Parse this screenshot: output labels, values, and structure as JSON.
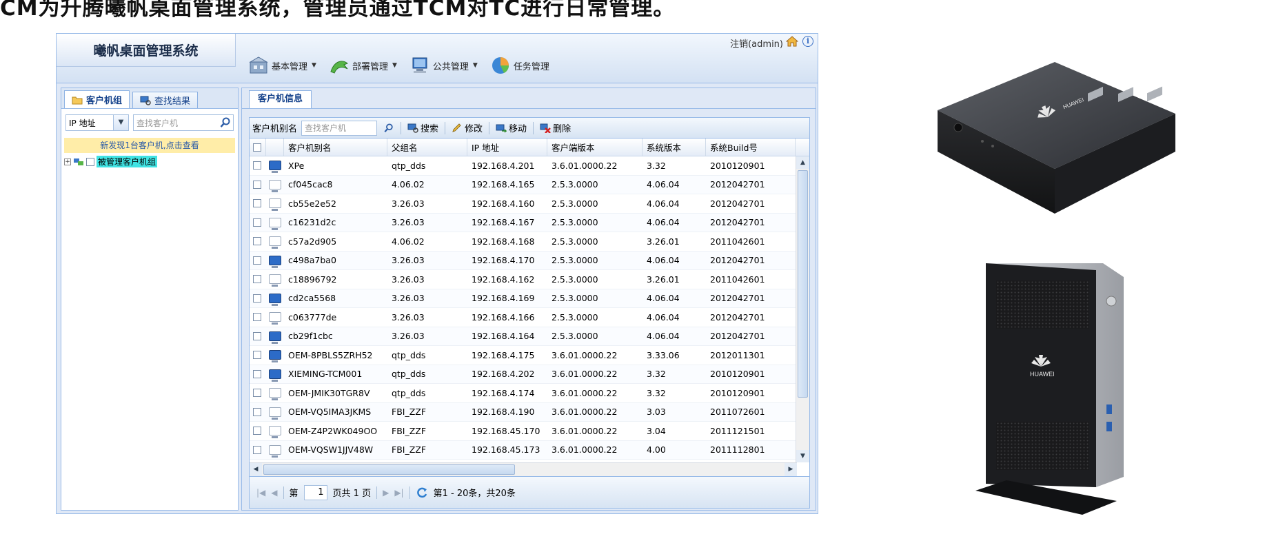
{
  "heading": "CM为升腾曦帆桌面管理系统，管理员通过TCM对TC进行日常管理。",
  "app": {
    "title": "曦帆桌面管理系统",
    "logout": "注销(admin)",
    "menu": [
      {
        "label": "基本管理",
        "icon": "basic-management-icon",
        "dropdown": true
      },
      {
        "label": "部署管理",
        "icon": "deploy-management-icon",
        "dropdown": true
      },
      {
        "label": "公共管理",
        "icon": "public-management-icon",
        "dropdown": true
      },
      {
        "label": "任务管理",
        "icon": "task-management-icon",
        "dropdown": false
      }
    ]
  },
  "left_panel": {
    "tabs": [
      "客户机组",
      "查找结果"
    ],
    "search_type": "IP 地址",
    "search_placeholder": "查找客户机",
    "new_found": "新发现1台客户机,点击查看",
    "tree_label": "被管理客户机组"
  },
  "right_panel": {
    "tab": "客户机信息",
    "toolbar": {
      "alias_label": "客户机别名",
      "alias_placeholder": "查找客户机",
      "search": "搜索",
      "edit": "修改",
      "move": "移动",
      "delete": "删除"
    },
    "columns": [
      "客户机别名",
      "父组名",
      "IP 地址",
      "客户端版本",
      "系统版本",
      "系统Build号"
    ],
    "rows": [
      {
        "online": true,
        "name": "XPe",
        "parent": "qtp_dds",
        "ip": "192.168.4.201",
        "client": "3.6.01.0000.22",
        "sys": "3.32",
        "build": "2010120901"
      },
      {
        "online": false,
        "name": "cf045cac8",
        "parent": "4.06.02",
        "ip": "192.168.4.165",
        "client": "2.5.3.0000",
        "sys": "4.06.04",
        "build": "2012042701"
      },
      {
        "online": false,
        "name": "cb55e2e52",
        "parent": "3.26.03",
        "ip": "192.168.4.160",
        "client": "2.5.3.0000",
        "sys": "4.06.04",
        "build": "2012042701"
      },
      {
        "online": false,
        "name": "c16231d2c",
        "parent": "3.26.03",
        "ip": "192.168.4.167",
        "client": "2.5.3.0000",
        "sys": "4.06.04",
        "build": "2012042701"
      },
      {
        "online": false,
        "name": "c57a2d905",
        "parent": "4.06.02",
        "ip": "192.168.4.168",
        "client": "2.5.3.0000",
        "sys": "3.26.01",
        "build": "2011042601"
      },
      {
        "online": true,
        "name": "c498a7ba0",
        "parent": "3.26.03",
        "ip": "192.168.4.170",
        "client": "2.5.3.0000",
        "sys": "4.06.04",
        "build": "2012042701"
      },
      {
        "online": false,
        "name": "c18896792",
        "parent": "3.26.03",
        "ip": "192.168.4.162",
        "client": "2.5.3.0000",
        "sys": "3.26.01",
        "build": "2011042601"
      },
      {
        "online": true,
        "name": "cd2ca5568",
        "parent": "3.26.03",
        "ip": "192.168.4.169",
        "client": "2.5.3.0000",
        "sys": "4.06.04",
        "build": "2012042701"
      },
      {
        "online": false,
        "name": "c063777de",
        "parent": "3.26.03",
        "ip": "192.168.4.166",
        "client": "2.5.3.0000",
        "sys": "4.06.04",
        "build": "2012042701"
      },
      {
        "online": true,
        "name": "cb29f1cbc",
        "parent": "3.26.03",
        "ip": "192.168.4.164",
        "client": "2.5.3.0000",
        "sys": "4.06.04",
        "build": "2012042701"
      },
      {
        "online": true,
        "name": "OEM-8PBLS5ZRH52",
        "parent": "qtp_dds",
        "ip": "192.168.4.175",
        "client": "3.6.01.0000.22",
        "sys": "3.33.06",
        "build": "2012011301"
      },
      {
        "online": true,
        "name": "XIEMING-TCM001",
        "parent": "qtp_dds",
        "ip": "192.168.4.202",
        "client": "3.6.01.0000.22",
        "sys": "3.32",
        "build": "2010120901"
      },
      {
        "online": false,
        "name": "OEM-JMIK30TGR8V",
        "parent": "qtp_dds",
        "ip": "192.168.4.174",
        "client": "3.6.01.0000.22",
        "sys": "3.32",
        "build": "2010120901"
      },
      {
        "online": false,
        "name": "OEM-VQ5IMA3JKMS",
        "parent": "FBI_ZZF",
        "ip": "192.168.4.190",
        "client": "3.6.01.0000.22",
        "sys": "3.03",
        "build": "2011072601"
      },
      {
        "online": false,
        "name": "OEM-Z4P2WK049OO",
        "parent": "FBI_ZZF",
        "ip": "192.168.45.170",
        "client": "3.6.01.0000.22",
        "sys": "3.04",
        "build": "2011121501"
      },
      {
        "online": false,
        "name": "OEM-VQSW1JJV48W",
        "parent": "FBI_ZZF",
        "ip": "192.168.45.173",
        "client": "3.6.01.0000.22",
        "sys": "4.00",
        "build": "2011112801"
      }
    ],
    "pager": {
      "page_label": "第",
      "page": "1",
      "total_label": "页共 1 页",
      "summary": "第1 - 20条，共20条"
    }
  },
  "devices": {
    "device1_brand": "HUAWEI",
    "device2_brand": "HUAWEI"
  },
  "colors": {
    "frame_border": "#99bbe8",
    "panel_bg": "#dfe8f6",
    "title_text": "#15428b",
    "highlight": "#41e3e3",
    "notice_bg": "#ffeda8"
  }
}
